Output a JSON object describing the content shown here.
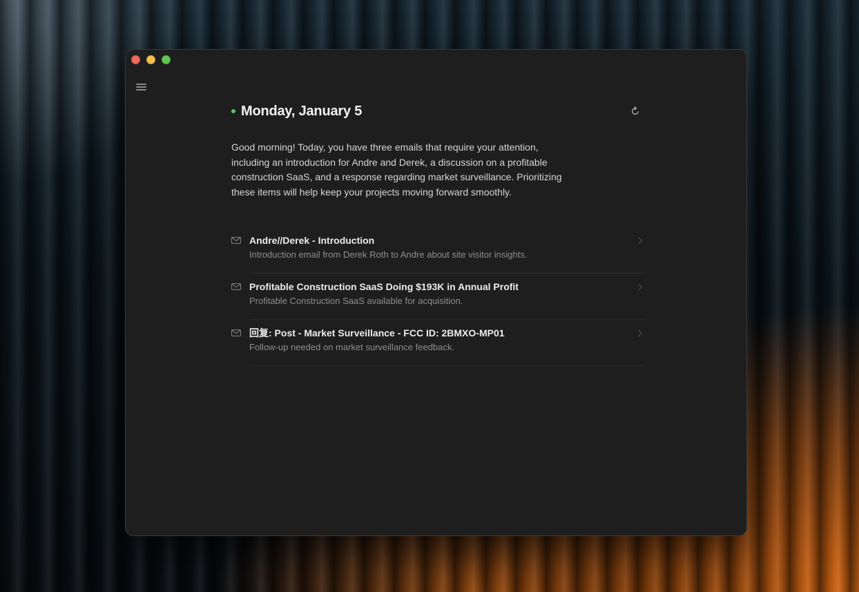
{
  "window": {
    "controls": [
      "close",
      "minimize",
      "maximize"
    ]
  },
  "header": {
    "date": "Monday, January 5",
    "status_color": "#5cc15a",
    "refresh_icon": "refresh-icon"
  },
  "summary": {
    "text": "Good morning! Today, you have three emails that require your attention, including an introduction for Andre and Derek, a discussion on a profitable construction SaaS, and a response regarding market surveillance. Prioritizing these items will help keep your projects moving forward smoothly."
  },
  "emails": [
    {
      "subject": "Andre//Derek - Introduction",
      "snippet": "Introduction email from Derek Roth to Andre about site visitor insights."
    },
    {
      "subject": "Profitable Construction SaaS Doing $193K in Annual Profit",
      "snippet": "Profitable Construction SaaS available for acquisition."
    },
    {
      "subject": "回复: Post - Market Surveillance - FCC ID: 2BMXO-MP01",
      "snippet": "Follow-up needed on market surveillance feedback."
    }
  ],
  "colors": {
    "window_bg": "#1e1e1e",
    "title_text": "#f2f2f2",
    "snippet_text": "#8e8e8e",
    "accent_green": "#5cc15a"
  }
}
